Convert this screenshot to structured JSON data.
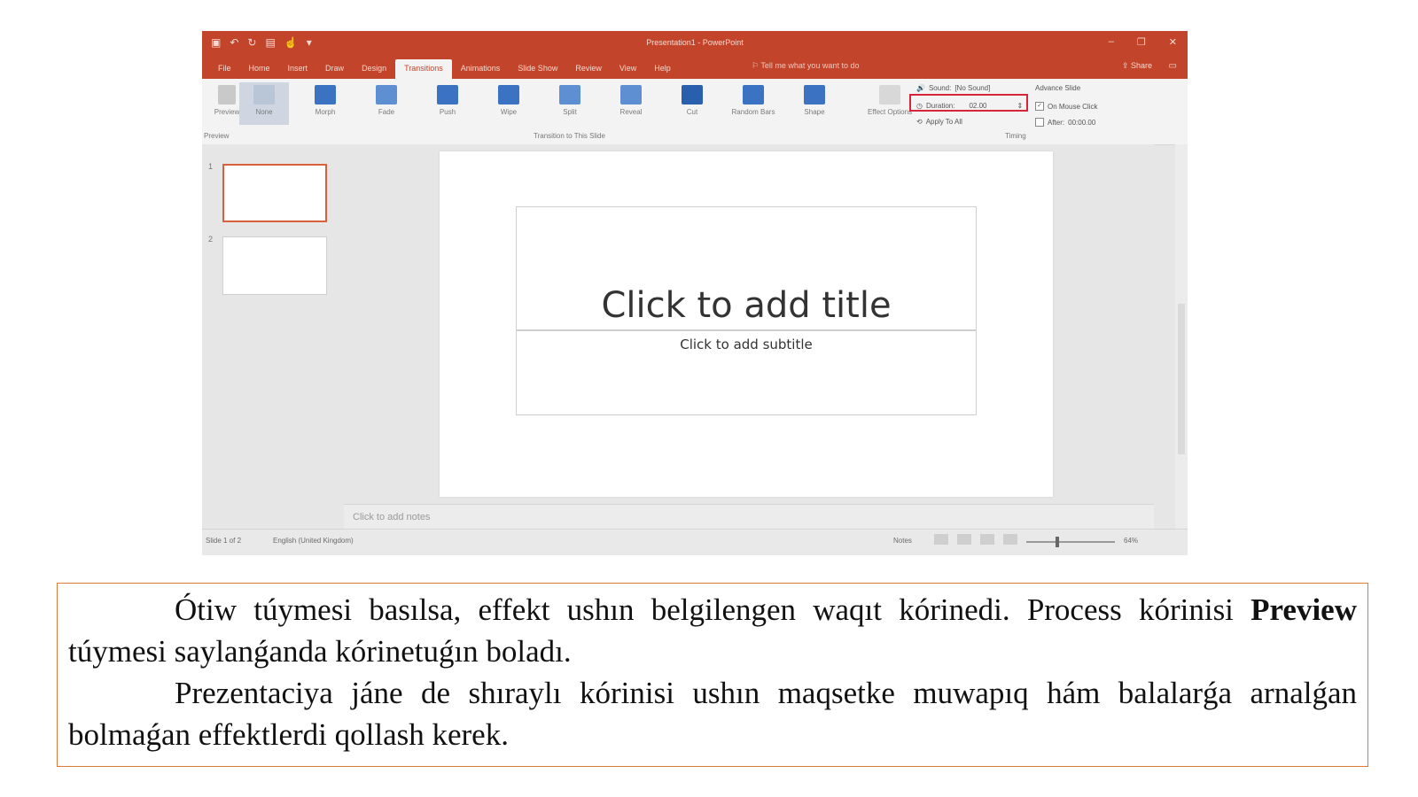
{
  "window": {
    "app_title": "Presentation1 - PowerPoint",
    "quick_access_icons": [
      "save-icon",
      "undo-icon",
      "redo-icon",
      "start-from-beginning-icon",
      "touch-mode-icon",
      "customize-icon"
    ],
    "controls": [
      "–",
      "❐",
      "✕"
    ]
  },
  "tabs": [
    "File",
    "Home",
    "Insert",
    "Draw",
    "Design",
    "Transitions",
    "Animations",
    "Slide Show",
    "Review",
    "View",
    "Help"
  ],
  "active_tab": "Transitions",
  "tell_me": "Tell me what you want to do",
  "share": "Share",
  "ribbon": {
    "preview_label": "Preview",
    "transitions": [
      {
        "label": "None",
        "color": "#b9c6d8"
      },
      {
        "label": "Morph",
        "color": "#3b73c2"
      },
      {
        "label": "Fade",
        "color": "#5d8fd2"
      },
      {
        "label": "Push",
        "color": "#3b73c2"
      },
      {
        "label": "Wipe",
        "color": "#3b73c2"
      },
      {
        "label": "Split",
        "color": "#5d8fd2"
      },
      {
        "label": "Reveal",
        "color": "#5d8fd2"
      },
      {
        "label": "Cut",
        "color": "#2a5fae"
      },
      {
        "label": "Random Bars",
        "color": "#3b73c2"
      },
      {
        "label": "Shape",
        "color": "#3b73c2"
      }
    ],
    "effect_options": "Effect Options",
    "group_preview": "Preview",
    "group_transition": "Transition to This Slide",
    "group_timing": "Timing",
    "sound_label": "Sound:",
    "sound_value": "[No Sound]",
    "duration_label": "Duration:",
    "duration_value": "02.00",
    "apply_all": "Apply To All",
    "advance_slide": "Advance Slide",
    "on_mouse_click": "On Mouse Click",
    "after_label": "After:",
    "after_value": "00:00.00",
    "highlight_color": "#d7263a"
  },
  "slides_panel": {
    "numbers": [
      "1",
      "2"
    ]
  },
  "slide": {
    "title_placeholder": "Click to add title",
    "subtitle_placeholder": "Click to add subtitle"
  },
  "notes_placeholder": "Click to add notes",
  "status": {
    "slide_count": "Slide 1 of 2",
    "language": "English (United Kingdom)",
    "notes": "Notes",
    "zoom": "64%"
  },
  "caption": {
    "p1_before": "Ótiw túymesi basılsa, effekt ushın belgilengen waqıt kórinedi. Process kórinisi ",
    "p1_bold": "Preview",
    "p1_after": " túymesi saylanǵanda kórinetuǵın boladı.",
    "p2": "Prezentaciya jáne de shıraylı kórinisi ushın maqsetke muwapıq hám balalarǵa arnalǵan bolmaǵan effektlerdi qollash kerek."
  },
  "colors": {
    "accent": "#c2442a",
    "caption_border": "#e07a3b",
    "thumb_selected": "#d9603d"
  }
}
